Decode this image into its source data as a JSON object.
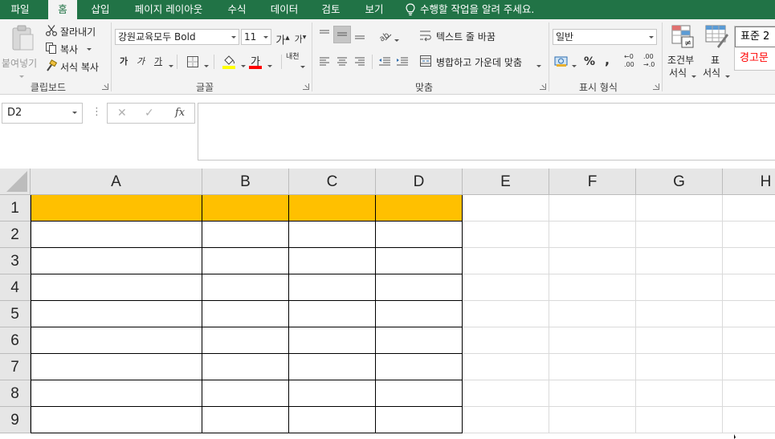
{
  "tabs": [
    {
      "label": "파일",
      "active": false
    },
    {
      "label": "홈",
      "active": true
    },
    {
      "label": "삽입",
      "active": false
    },
    {
      "label": "페이지 레이아웃",
      "active": false
    },
    {
      "label": "수식",
      "active": false
    },
    {
      "label": "데이터",
      "active": false
    },
    {
      "label": "검토",
      "active": false
    },
    {
      "label": "보기",
      "active": false
    }
  ],
  "tell_me": "수행할 작업을 알려 주세요.",
  "clipboard": {
    "paste_label": "붙여넣기",
    "cut_label": "잘라내기",
    "copy_label": "복사",
    "format_painter_label": "서식 복사",
    "group_label": "클립보드"
  },
  "font": {
    "font_name": "강원교육모두 Bold",
    "font_size": "11",
    "grow_label": "가",
    "shrink_label": "가",
    "bold_label": "가",
    "italic_label": "가",
    "underline_label": "가",
    "font_color_label": "가",
    "phonetic_label": "내천",
    "group_label": "글꼴"
  },
  "alignment": {
    "wrap_text_label": "텍스트 줄 바꿈",
    "merge_label": "병합하고 가운데 맞춤",
    "group_label": "맞춤"
  },
  "number": {
    "format": "일반",
    "percent_label": "%",
    "comma_label": ",",
    "inc_decimal_label": ".00",
    "dec_decimal_label": ".00",
    "group_label": "표시 형식"
  },
  "styles": {
    "conditional_label_1": "조건부",
    "conditional_label_2": "서식",
    "table_label_1": "표",
    "table_label_2": "서식",
    "style_normal": "표준 2",
    "style_warning": "경고문"
  },
  "formula_bar": {
    "name_box": "D2",
    "fx_label": "fx",
    "formula": ""
  },
  "columns": [
    "A",
    "B",
    "C",
    "D",
    "E",
    "F",
    "G",
    "H"
  ],
  "rows": [
    "1",
    "2",
    "3",
    "4",
    "5",
    "6",
    "7",
    "8",
    "9"
  ],
  "colors": {
    "ribbon_green": "#217346",
    "header_fill": "#ffc000",
    "warning_text": "#ff0000"
  }
}
